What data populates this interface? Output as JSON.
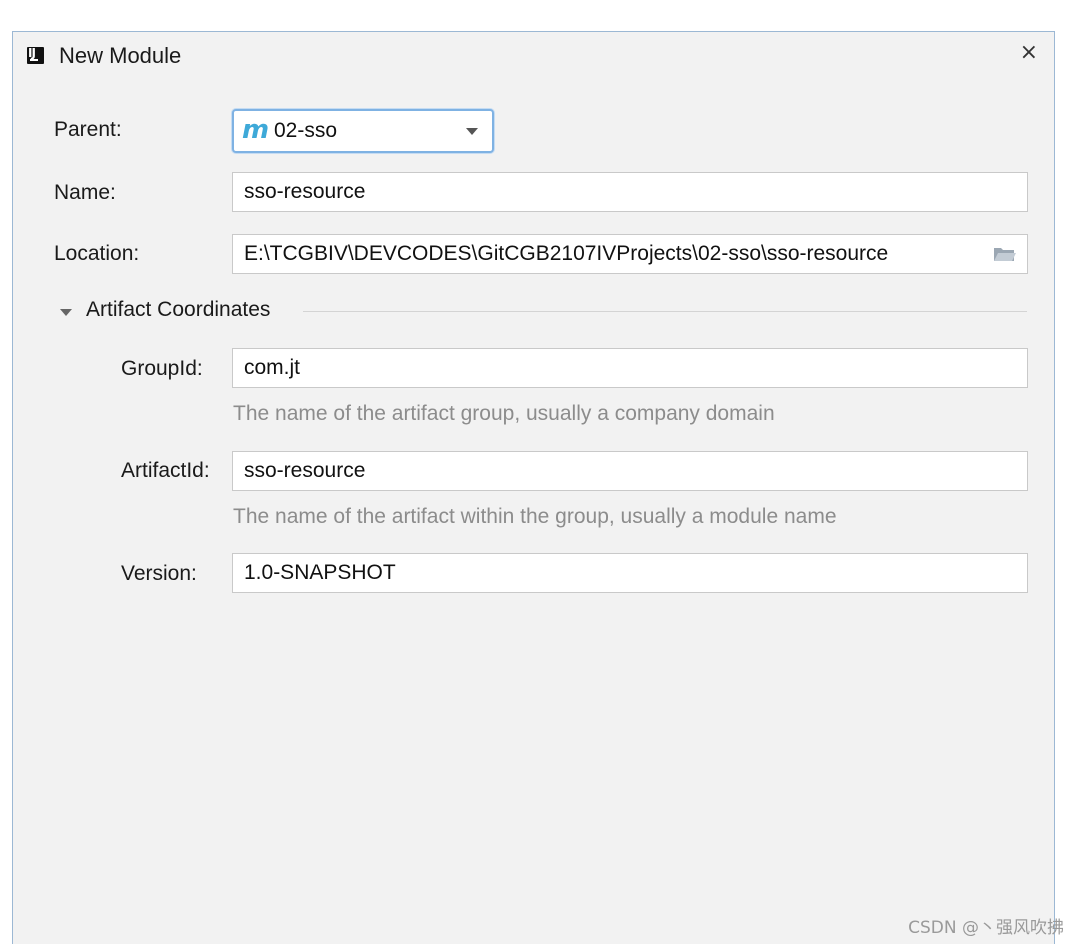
{
  "window": {
    "title": "New Module",
    "close_glyph": "×"
  },
  "form": {
    "parent_label": "Parent:",
    "parent_value": "02-sso",
    "parent_icon": "m",
    "name_label": "Name:",
    "name_value": "sso-resource",
    "location_label": "Location:",
    "location_value": "E:\\TCGBIV\\DEVCODES\\GitCGB2107IVProjects\\02-sso\\sso-resource"
  },
  "artifact": {
    "section_title": "Artifact Coordinates",
    "groupid_label": "GroupId:",
    "groupid_value": "com.jt",
    "groupid_hint": "The name of the artifact group, usually a company domain",
    "artifactid_label": "ArtifactId:",
    "artifactid_value": "sso-resource",
    "artifactid_hint": "The name of the artifact within the group, usually a module name",
    "version_label": "Version:",
    "version_value": "1.0-SNAPSHOT"
  },
  "watermark": "CSDN @丶强风吹拂",
  "colors": {
    "dialog_bg": "#f2f2f2",
    "focus_border": "#7fb2e3",
    "maven_icon": "#3ea9d8",
    "hint_text": "#8c8c8c"
  }
}
